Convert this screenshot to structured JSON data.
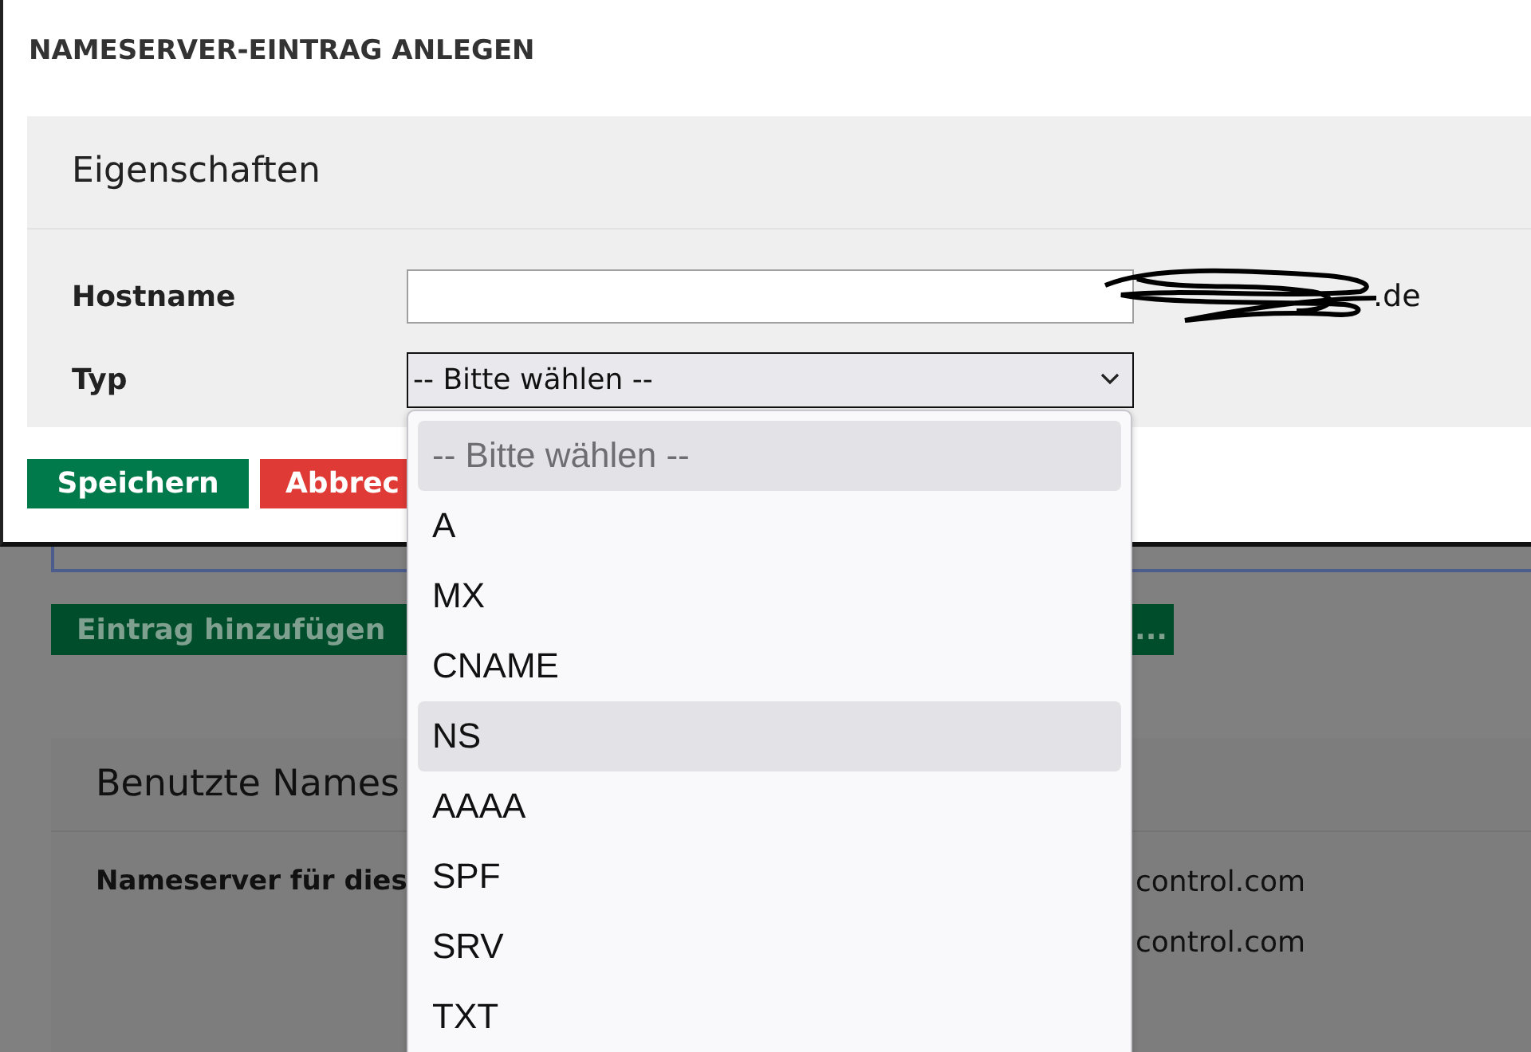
{
  "dialog": {
    "title": "NAMESERVER-EINTRAG ANLEGEN",
    "section_title": "Eigenschaften",
    "hostname": {
      "label": "Hostname",
      "suffix": ".de"
    },
    "type": {
      "label": "Typ",
      "value": "-- Bitte wählen --"
    },
    "buttons": [
      {
        "label": "Speichern",
        "kind": "primary"
      },
      {
        "label": "Abbrec",
        "kind": "danger"
      }
    ]
  },
  "dropdown": {
    "options": [
      {
        "label": "-- Bitte wählen --",
        "disabled": true,
        "highlighted": true
      },
      {
        "label": "A",
        "disabled": false,
        "highlighted": false
      },
      {
        "label": "MX",
        "disabled": false,
        "highlighted": false
      },
      {
        "label": "CNAME",
        "disabled": false,
        "highlighted": false
      },
      {
        "label": "NS",
        "disabled": false,
        "highlighted": true
      },
      {
        "label": "AAAA",
        "disabled": false,
        "highlighted": false
      },
      {
        "label": "SPF",
        "disabled": false,
        "highlighted": false
      },
      {
        "label": "SRV",
        "disabled": false,
        "highlighted": false
      },
      {
        "label": "TXT",
        "disabled": false,
        "highlighted": false
      }
    ]
  },
  "page": {
    "add_button": {
      "label": "Eintrag hinzufügen",
      "tail": "..."
    },
    "card": {
      "title": "Benutzte Names",
      "rows": [
        {
          "label": "Nameserver für dies",
          "value": "control.com"
        },
        {
          "value": "control.com"
        }
      ]
    }
  }
}
